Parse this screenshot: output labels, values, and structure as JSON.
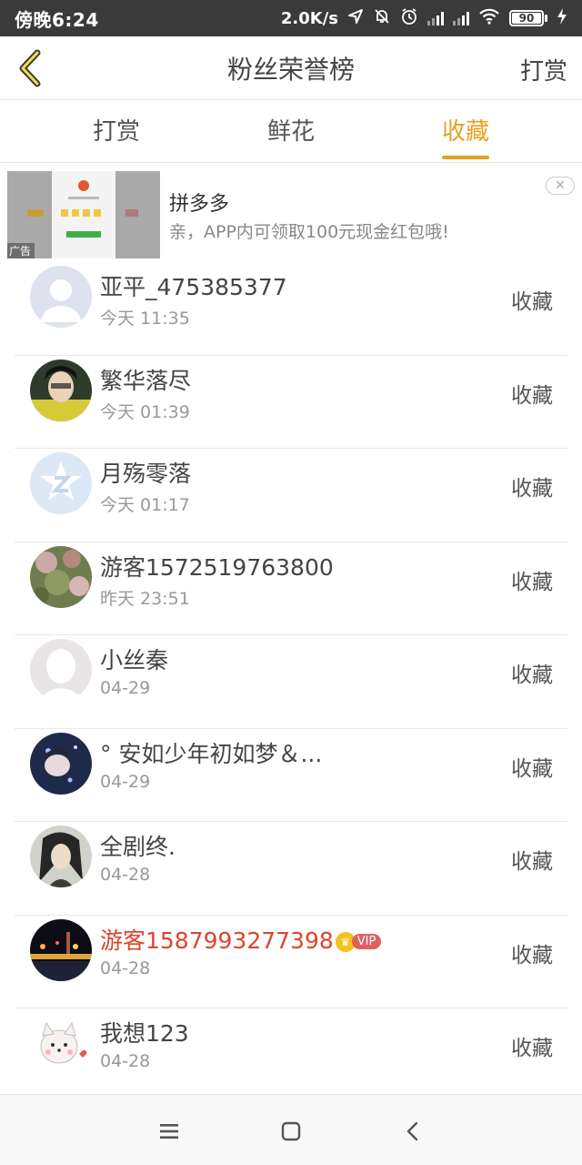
{
  "status_bar": {
    "time": "傍晚6:24",
    "net_speed": "2.0K/s",
    "battery": "90",
    "icons": [
      "location-icon",
      "mute-bell-icon",
      "alarm-icon",
      "signal-icon",
      "signal-icon",
      "wifi-icon",
      "battery-icon",
      "charging-icon"
    ]
  },
  "header": {
    "title": "粉丝荣誉榜",
    "back_icon": "chevron-left-icon",
    "action_label": "打赏"
  },
  "tabs": [
    {
      "label": "打赏",
      "active": false
    },
    {
      "label": "鲜花",
      "active": false
    },
    {
      "label": "收藏",
      "active": true
    }
  ],
  "accent_color": "#e8a020",
  "ad": {
    "title": "拼多多",
    "desc": "亲，APP内可领取100元现金红包哦!",
    "tag": "广告",
    "close_icon": "close-icon"
  },
  "list": [
    {
      "name": "亚平_475385377",
      "time": "今天 11:35",
      "action": "收藏",
      "vip": false
    },
    {
      "name": "繁华落尽",
      "time": "今天 01:39",
      "action": "收藏",
      "vip": false
    },
    {
      "name": "月殇零落",
      "time": "今天 01:17",
      "action": "收藏",
      "vip": false
    },
    {
      "name": "游客1572519763800",
      "time": "昨天 23:51",
      "action": "收藏",
      "vip": false
    },
    {
      "name": "小丝秦",
      "time": "04-29",
      "action": "收藏",
      "vip": false
    },
    {
      "name": "° 安如少年初如梦＆...",
      "time": "04-29",
      "action": "收藏",
      "vip": false
    },
    {
      "name": "全剧终.",
      "time": "04-28",
      "action": "收藏",
      "vip": false
    },
    {
      "name": "游客1587993277398",
      "time": "04-28",
      "action": "收藏",
      "vip": true,
      "vip_label": "VIP"
    },
    {
      "name": "我想123",
      "time": "04-28",
      "action": "收藏",
      "vip": false
    }
  ],
  "bottom_nav": [
    "menu-icon",
    "home-icon",
    "back-icon"
  ]
}
